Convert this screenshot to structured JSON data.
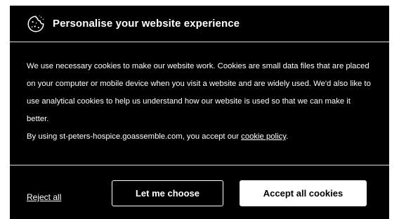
{
  "modal": {
    "title": "Personalise your website experience",
    "icon": "cookie-icon",
    "body_paragraph": "We use necessary cookies to make our website work. Cookies are small data files that are placed on your computer or mobile device when you visit a website and are widely used. We'd also like to use analytical cookies to help us understand how our website is used so that we can make it better.",
    "site_notice_prefix": "By using st-peters-hospice.goassemble.com, you accept our",
    "cookie_policy_link": "cookie policy",
    "site_notice_suffix": "."
  },
  "actions": {
    "reject_all": "Reject all",
    "let_me_choose": "Let me choose",
    "accept_all": "Accept all cookies"
  },
  "colors": {
    "modal_background": "#000000",
    "text": "#ffffff",
    "divider": "#d9d9d9",
    "primary_button_bg": "#ffffff",
    "primary_button_text": "#000000",
    "background_heading": "#1f3a9a"
  }
}
